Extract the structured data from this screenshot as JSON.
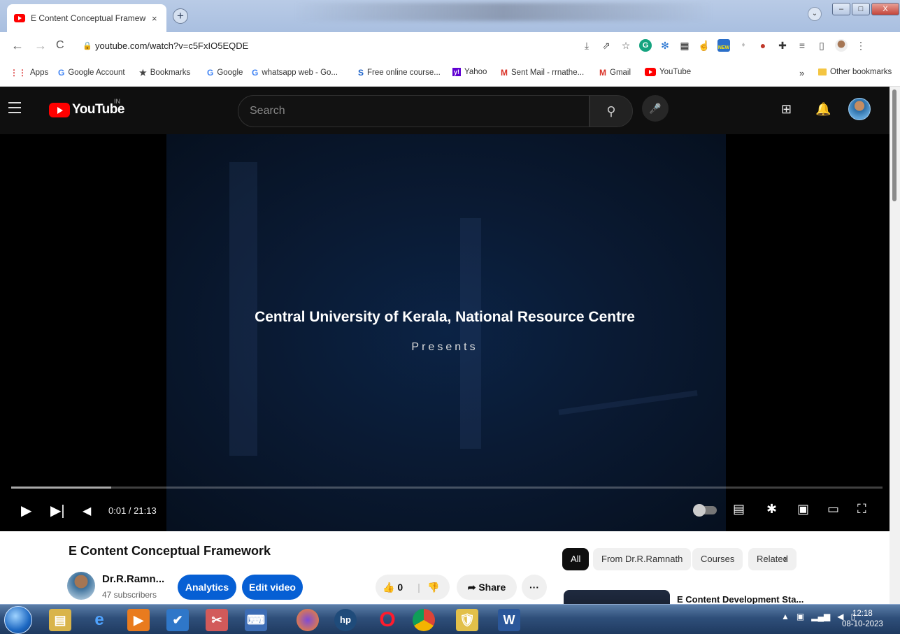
{
  "browser": {
    "tab_title": "E Content Conceptual Framework",
    "tab_close": "×",
    "new_tab": "+",
    "url": "youtube.com/watch?v=c5FxIO5EQDE",
    "bookmarks": [
      "Apps",
      "Google Account",
      "Bookmarks",
      "Google",
      "whatsapp web - Go...",
      "Free online course...",
      "Yahoo",
      "Sent Mail - rrnathe...",
      "Gmail",
      "YouTube"
    ],
    "bookmarks_more": "»",
    "other_bookmarks": "Other bookmarks",
    "ext_new_badge": "NEW"
  },
  "youtube": {
    "logo_word": "YouTube",
    "country_code": "IN",
    "search_placeholder": "Search"
  },
  "player": {
    "title_line": "Central University of Kerala, National Resource Centre",
    "presents": "Presents",
    "time": "0:01 / 21:13",
    "progress": 0.115
  },
  "video": {
    "title": "E Content Conceptual Framework",
    "channel": "Dr.R.Ramn...",
    "subscribers": "47 subscribers",
    "analytics": "Analytics",
    "edit_video": "Edit video",
    "likes": "0",
    "share": "Share",
    "more": "···"
  },
  "chips": [
    "All",
    "From Dr.R.Ramnath",
    "Courses",
    "Related"
  ],
  "rec_title": "E Content Development Sta...",
  "taskbar": {
    "time": "12:18",
    "date": "08-10-2023"
  },
  "colors": {
    "yt_red": "#ff0000",
    "yt_blue": "#065fd4",
    "yt_dark": "#0f0f0f"
  }
}
